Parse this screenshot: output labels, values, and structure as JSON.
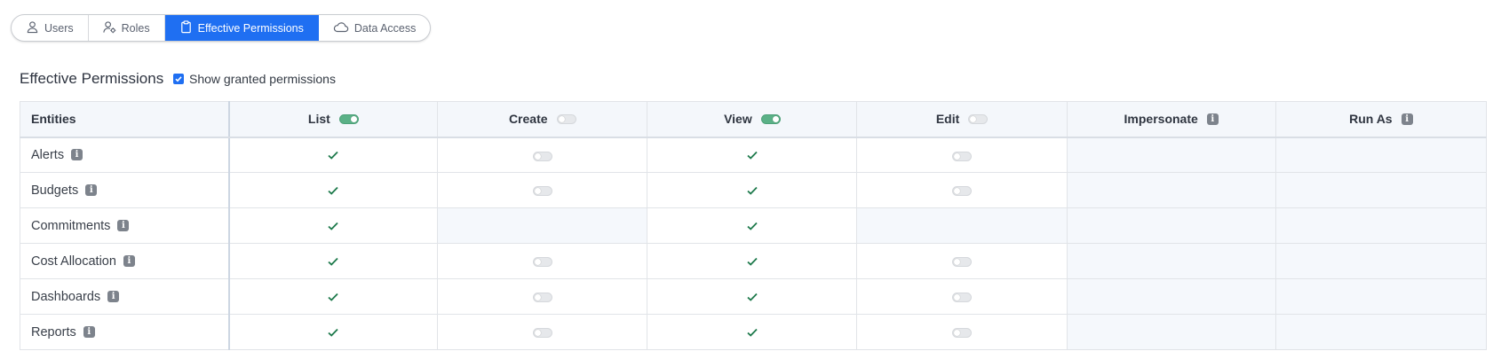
{
  "tabs": [
    {
      "label": "Users",
      "icon": "user-icon",
      "active": false
    },
    {
      "label": "Roles",
      "icon": "user-gear-icon",
      "active": false
    },
    {
      "label": "Effective Permissions",
      "icon": "clipboard-icon",
      "active": true
    },
    {
      "label": "Data Access",
      "icon": "cloud-icon",
      "active": false
    }
  ],
  "section": {
    "title": "Effective Permissions",
    "show_granted_label": "Show granted permissions",
    "show_granted_checked": true
  },
  "table": {
    "headers": {
      "entities": "Entities",
      "list": "List",
      "create": "Create",
      "view": "View",
      "edit": "Edit",
      "impersonate": "Impersonate",
      "run_as": "Run As"
    },
    "header_toggles": {
      "list": true,
      "create": false,
      "view": true,
      "edit": false
    },
    "rows": [
      {
        "entity": "Alerts",
        "list": "check",
        "create": "toggle-off",
        "view": "check",
        "edit": "toggle-off"
      },
      {
        "entity": "Budgets",
        "list": "check",
        "create": "toggle-off",
        "view": "check",
        "edit": "toggle-off"
      },
      {
        "entity": "Commitments",
        "list": "check",
        "create": "none",
        "view": "check",
        "edit": "none"
      },
      {
        "entity": "Cost Allocation",
        "list": "check",
        "create": "toggle-off",
        "view": "check",
        "edit": "toggle-off"
      },
      {
        "entity": "Dashboards",
        "list": "check",
        "create": "toggle-off",
        "view": "check",
        "edit": "toggle-off"
      },
      {
        "entity": "Reports",
        "list": "check",
        "create": "toggle-off",
        "view": "check",
        "edit": "toggle-off"
      }
    ]
  },
  "colors": {
    "accent": "#1f6ff2",
    "check": "#1e7a4c",
    "toggle_on": "#5bb187",
    "header_bg": "#f4f7fb"
  }
}
